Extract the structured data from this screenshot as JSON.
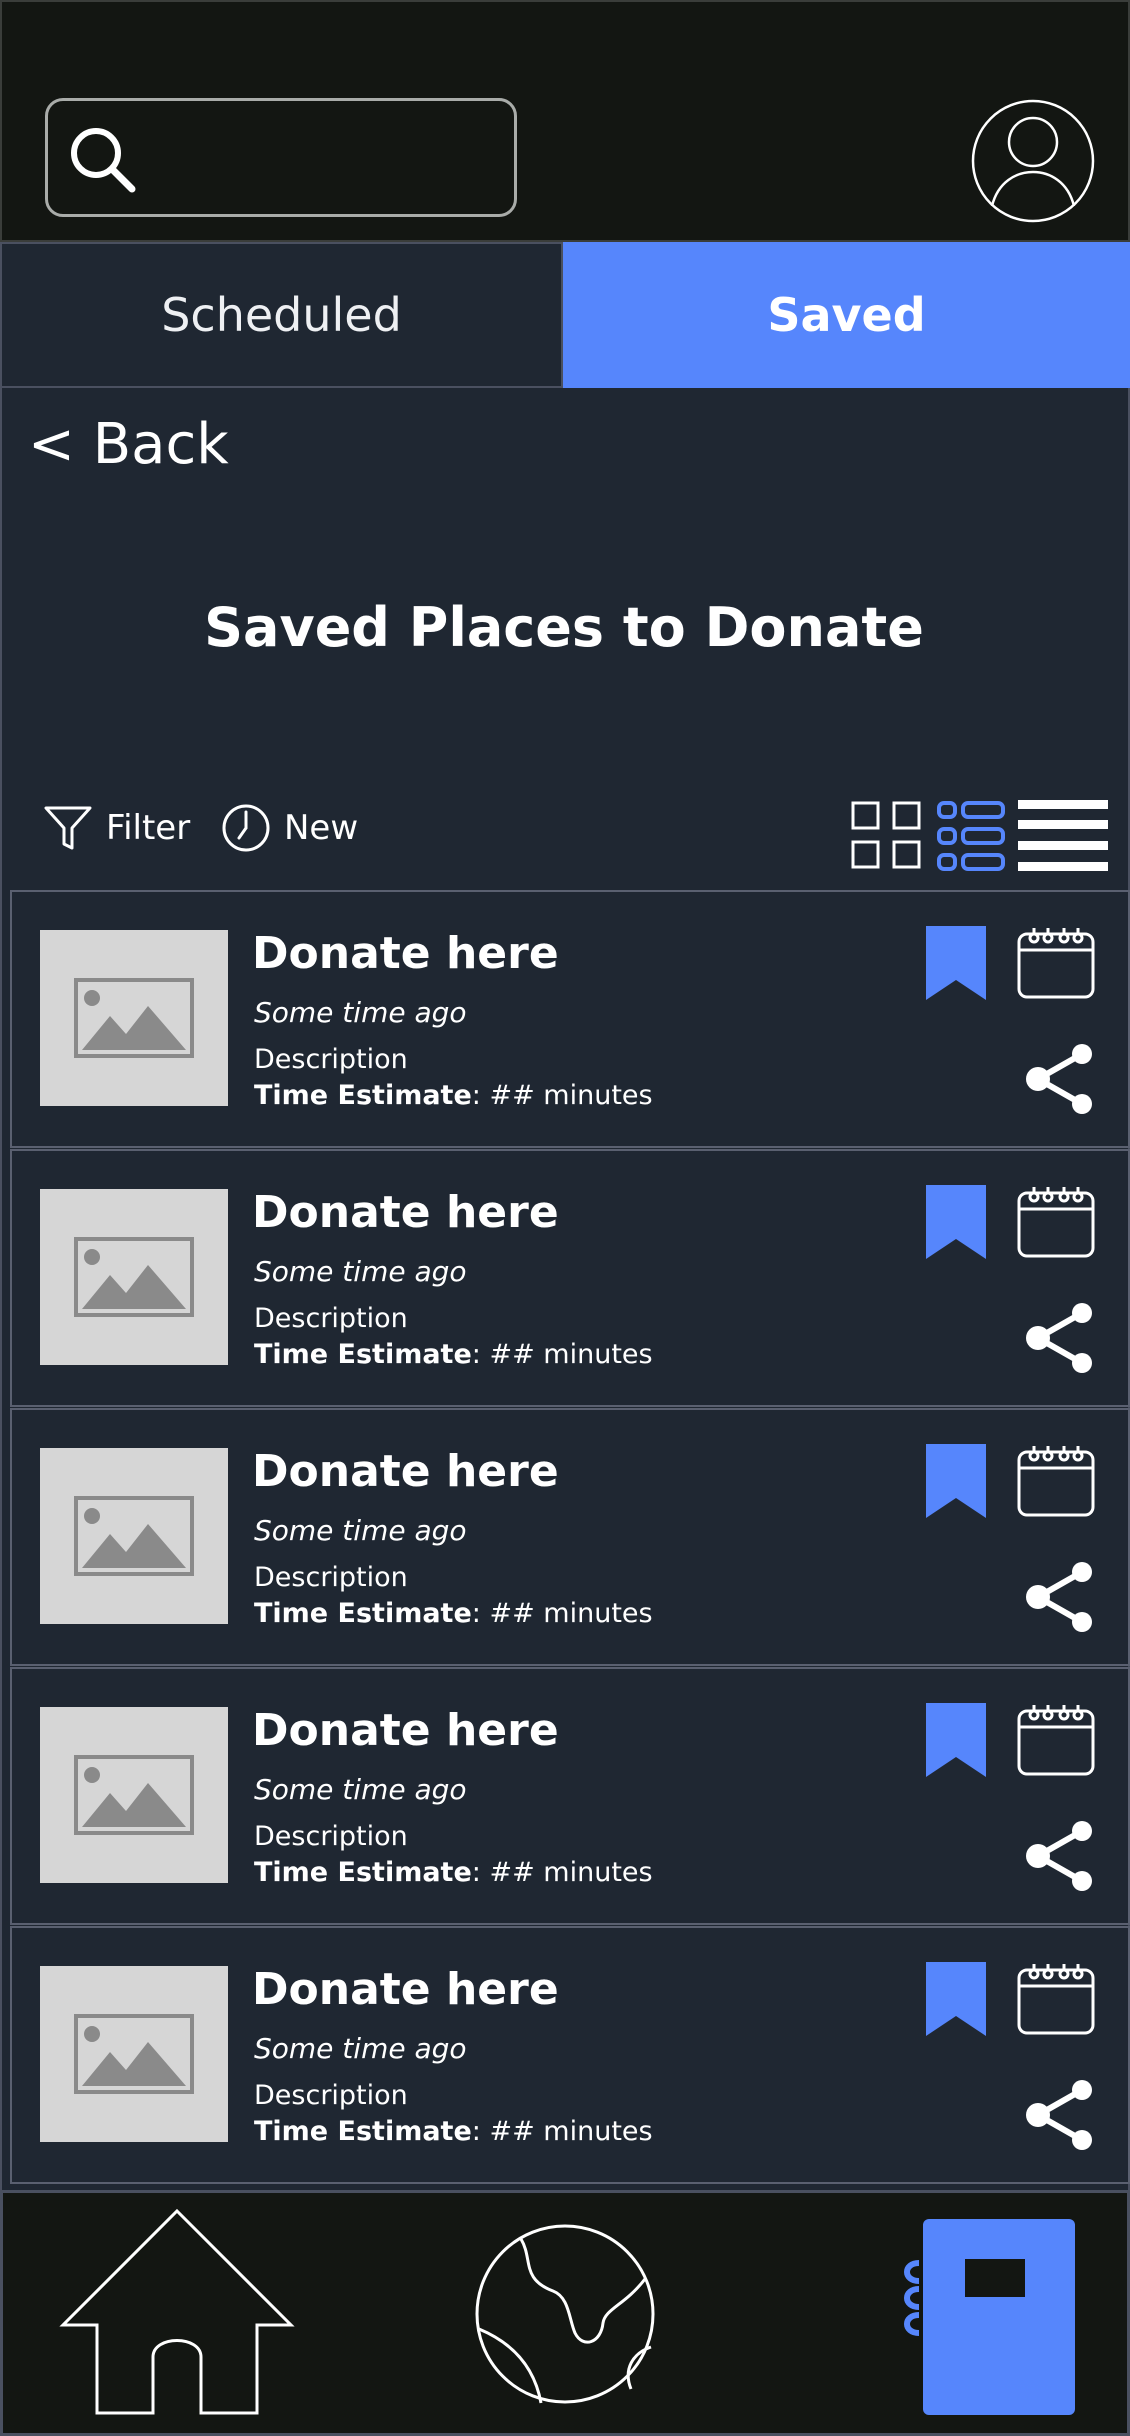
{
  "search": {
    "value": "",
    "placeholder": ""
  },
  "tabs": {
    "scheduled": "Scheduled",
    "saved": "Saved",
    "active": "Saved"
  },
  "nav": {
    "back": "< Back"
  },
  "page": {
    "title": "Saved Places to Donate"
  },
  "toolbar": {
    "filter": "Filter",
    "new": "New",
    "views": [
      "grid-view",
      "list-detail-view",
      "compact-list-view"
    ],
    "active_view": "list-detail-view"
  },
  "colors": {
    "accent": "#5686fc",
    "background": "#1f2732",
    "topbar": "#131612"
  },
  "items": [
    {
      "name": "Donate here",
      "time": "Some time ago",
      "description": "Description",
      "estimate_label": "Time Estimate",
      "estimate_value": ": ## minutes",
      "bookmarked": true
    },
    {
      "name": "Donate here",
      "time": "Some time ago",
      "description": "Description",
      "estimate_label": "Time Estimate",
      "estimate_value": ": ## minutes",
      "bookmarked": true
    },
    {
      "name": "Donate here",
      "time": "Some time ago",
      "description": "Description",
      "estimate_label": "Time Estimate",
      "estimate_value": ": ## minutes",
      "bookmarked": true
    },
    {
      "name": "Donate here",
      "time": "Some time ago",
      "description": "Description",
      "estimate_label": "Time Estimate",
      "estimate_value": ": ## minutes",
      "bookmarked": true
    },
    {
      "name": "Donate here",
      "time": "Some time ago",
      "description": "Description",
      "estimate_label": "Time Estimate",
      "estimate_value": ": ## minutes",
      "bookmarked": true
    }
  ],
  "icons": {
    "search": "search-icon",
    "avatar": "user-avatar-icon",
    "filter": "filter-icon",
    "new": "clock-icon",
    "bookmark": "bookmark-icon",
    "calendar": "calendar-icon",
    "share": "share-icon",
    "thumbnail": "image-placeholder-icon",
    "home": "home-icon",
    "globe": "globe-icon",
    "notebook": "notebook-icon"
  },
  "bottom_nav": {
    "active": "notebook"
  }
}
